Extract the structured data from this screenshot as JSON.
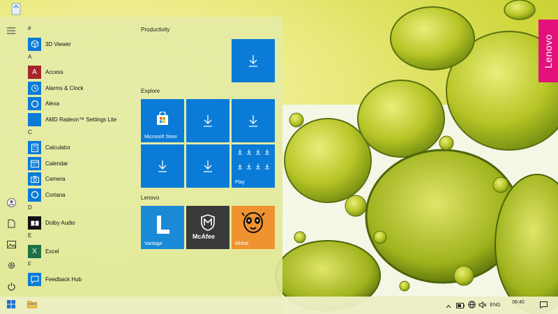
{
  "wallpaper": {
    "brand_text": "Lenovo",
    "brand_color": "#e2127a"
  },
  "desktop": {
    "recycle_bin_icon": "recycle-bin-icon"
  },
  "rail": {
    "items": [
      {
        "name": "hamburger-menu-icon"
      },
      {
        "name": "user-avatar-icon"
      },
      {
        "name": "documents-icon"
      },
      {
        "name": "pictures-icon"
      },
      {
        "name": "settings-gear-icon"
      },
      {
        "name": "power-icon"
      }
    ]
  },
  "applist": {
    "sections": [
      {
        "letter": "#",
        "apps": [
          {
            "name": "3D Viewer",
            "color": "#0a7bd6",
            "glyph": "◈"
          }
        ]
      },
      {
        "letter": "A",
        "apps": [
          {
            "name": "Access",
            "color": "#a4262c",
            "glyph": "A"
          },
          {
            "name": "Alarms & Clock",
            "color": "#0a7bd6",
            "glyph": "◷"
          },
          {
            "name": "Alexa",
            "color": "#0a7bd6",
            "glyph": "○"
          },
          {
            "name": "AMD Radeon™ Settings Lite",
            "color": "#0a7bd6",
            "glyph": ""
          }
        ]
      },
      {
        "letter": "C",
        "apps": [
          {
            "name": "Calculator",
            "color": "#0a7bd6",
            "glyph": "▦"
          },
          {
            "name": "Calendar",
            "color": "#0a7bd6",
            "glyph": "▤"
          },
          {
            "name": "Camera",
            "color": "#0a7bd6",
            "glyph": "◉"
          },
          {
            "name": "Cortana",
            "color": "#0a7bd6",
            "glyph": "○"
          }
        ]
      },
      {
        "letter": "D",
        "apps": [
          {
            "name": "Dolby Audio",
            "color": "#111111",
            "glyph": "▮▮"
          }
        ]
      },
      {
        "letter": "E",
        "apps": [
          {
            "name": "Excel",
            "color": "#1e7145",
            "glyph": "X"
          }
        ]
      },
      {
        "letter": "F",
        "apps": [
          {
            "name": "Feedback Hub",
            "color": "#0a7bd6",
            "glyph": "☺"
          }
        ]
      }
    ]
  },
  "tiles": {
    "groups": [
      {
        "title": "Productivity"
      },
      {
        "title": "Explore"
      },
      {
        "title": "Lenovo"
      }
    ],
    "labels": {
      "store": "Microsoft Store",
      "play": "Play",
      "vantage": "Vantage",
      "mcafee": "McAfee",
      "mirkat": "Mirkat"
    },
    "tile_color": "#0a7bd6",
    "vantage_color": "#1a8ad6",
    "mcafee_color": "#3a3a3a",
    "mirkat_color": "#f0922f"
  },
  "taskbar": {
    "start_icon": "windows-logo-icon",
    "explorer_icon": "file-explorer-icon",
    "tray": {
      "language": "ENG",
      "time": "06:40"
    }
  }
}
